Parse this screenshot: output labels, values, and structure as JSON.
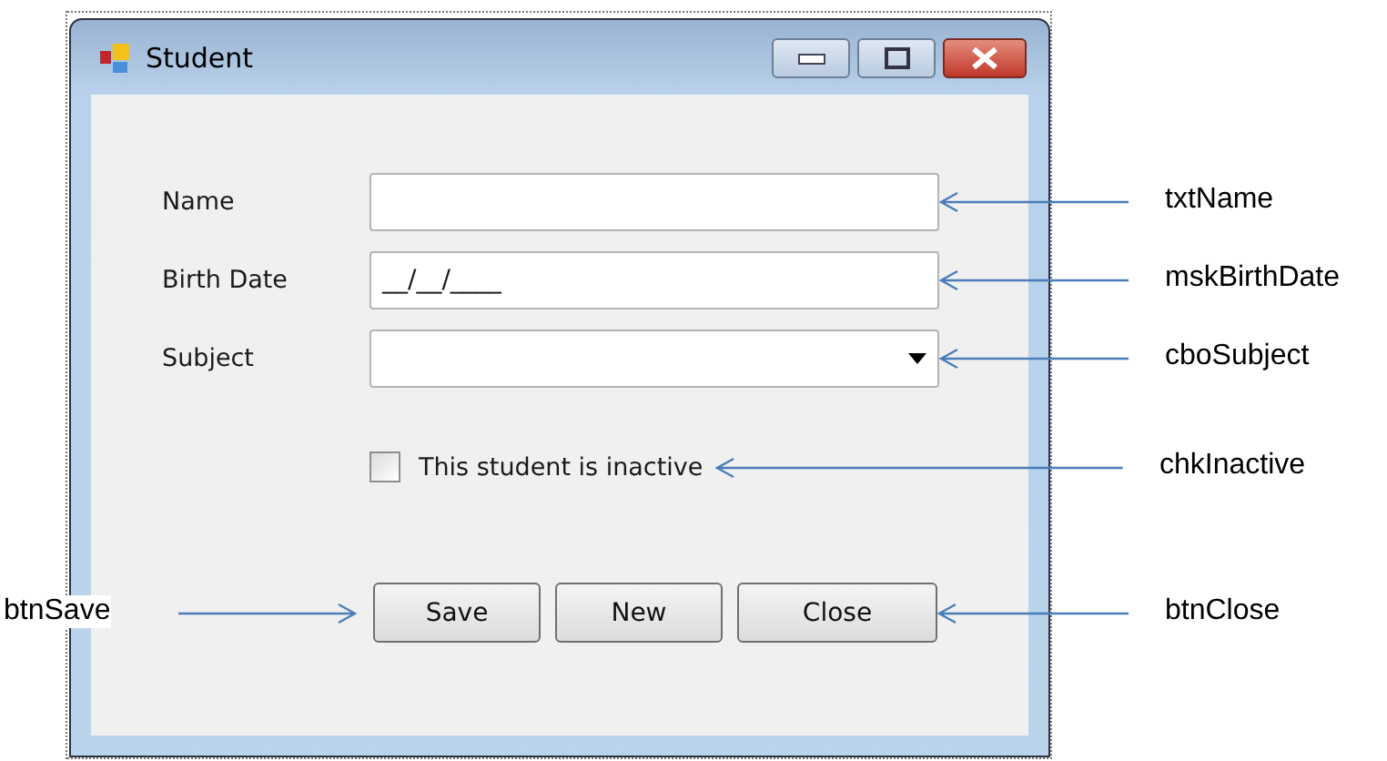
{
  "window": {
    "title": "Student"
  },
  "fields": [
    {
      "label": "Name",
      "kind": "text",
      "annotation": "txtName"
    },
    {
      "label": "Birth Date",
      "kind": "masked",
      "value": "__/__/____",
      "annotation": "mskBirthDate"
    },
    {
      "label": "Subject",
      "kind": "combo",
      "annotation": "cboSubject"
    }
  ],
  "checkbox": {
    "label": "This student is inactive",
    "checked": false,
    "annotation": "chkInactive"
  },
  "buttons": [
    {
      "label": "Save",
      "annotation_left": "btnSave"
    },
    {
      "label": "New"
    },
    {
      "label": "Close",
      "annotation": "btnClose"
    }
  ]
}
